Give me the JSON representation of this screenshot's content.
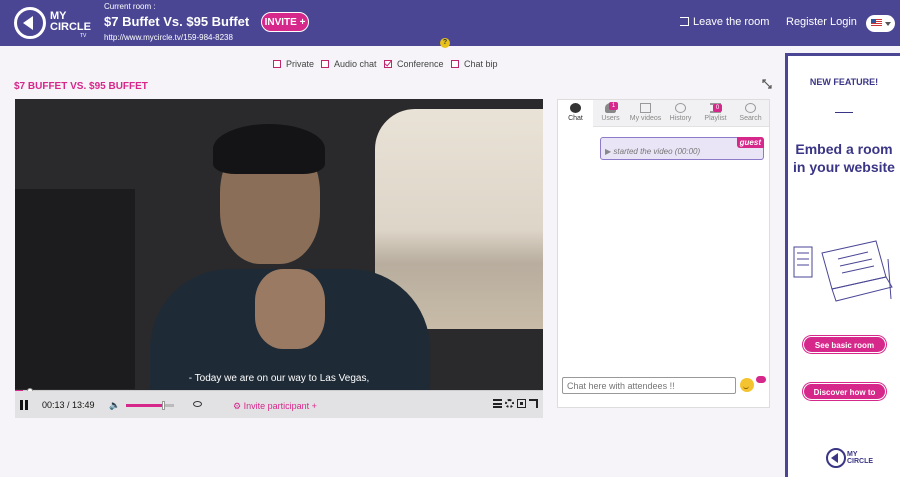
{
  "header": {
    "logo_text_1": "MY",
    "logo_text_2": "CIRCLE",
    "logo_text_tv": "TV",
    "current_room_label": "Current room :",
    "room_title": "$7 Buffet Vs. $95 Buffet",
    "room_url": "http://www.mycircle.tv/159-984-8238",
    "invite_label": "INVITE +",
    "leave_label": "Leave the room",
    "register_label": "Register",
    "login_label": "Login",
    "language_flag": "us-flag-icon",
    "help_label": "?"
  },
  "options": {
    "private": {
      "label": "Private",
      "checked": false
    },
    "audio_chat": {
      "label": "Audio chat",
      "checked": false
    },
    "conference": {
      "label": "Conference",
      "checked": true
    },
    "chat_bip": {
      "label": "Chat bip",
      "checked": false
    }
  },
  "page_title": "$7 BUFFET VS. $95 BUFFET",
  "video": {
    "subtitle": "- Today we are on our way to Las Vegas,",
    "current_time": "00:13",
    "duration": "13:49",
    "time_display": "00:13 / 13:49",
    "progress": 0.016,
    "volume": 0.75,
    "invite_participant_label": "Invite participant +"
  },
  "chat": {
    "tabs": [
      {
        "label": "Chat",
        "icon": "chat-bubbles-icon",
        "active": true
      },
      {
        "label": "Users",
        "icon": "users-icon",
        "badge": "1"
      },
      {
        "label": "My videos",
        "icon": "document-icon"
      },
      {
        "label": "History",
        "icon": "history-icon"
      },
      {
        "label": "Playlist",
        "icon": "playlist-icon",
        "badge": "0"
      },
      {
        "label": "Search",
        "icon": "search-icon"
      }
    ],
    "messages": [
      {
        "author": "guest",
        "text": "started the video",
        "time": "(00:00)"
      }
    ],
    "input_placeholder": "Chat here with attendees !!"
  },
  "ad": {
    "new_feature": "NEW FEATURE!",
    "headline": "Embed a room in your website",
    "button_basic": "See basic room",
    "button_discover": "Discover how to",
    "logo_text_1": "MY",
    "logo_text_2": "CIRCLE"
  },
  "colors": {
    "brand_purple": "#4a4694",
    "accent_pink": "#d6278a"
  }
}
